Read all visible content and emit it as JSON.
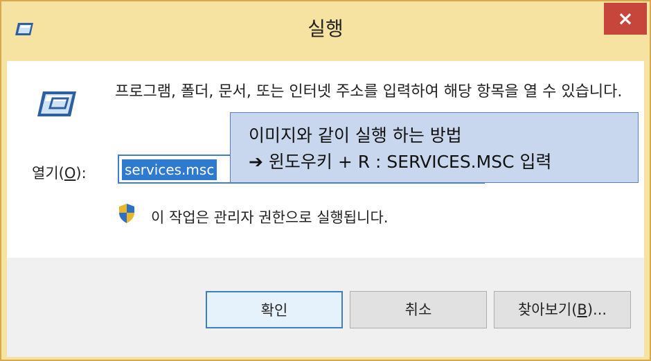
{
  "window": {
    "title": "실행",
    "close_label": "×"
  },
  "content": {
    "description": "프로그램, 폴더, 문서, 또는 인터넷 주소를 입력하여 해당 항목을 열 수 있습니다.",
    "open_label_prefix": "열기(",
    "open_label_key": "O",
    "open_label_suffix": "):",
    "input_value": "services.msc",
    "admin_text": "이 작업은 관리자 권한으로 실행됩니다."
  },
  "tooltip": {
    "line1": "이미지와 같이 실행 하는 방법",
    "line2": "➔ 윈도우키 + R : SERVICES.MSC 입력"
  },
  "buttons": {
    "ok": "확인",
    "cancel": "취소",
    "browse_prefix": "찾아보기(",
    "browse_key": "B",
    "browse_suffix": ")..."
  },
  "colors": {
    "titlebar": "#f7e3a1",
    "close": "#c7463c",
    "selection": "#2f7ad1",
    "tooltip_bg": "#c9d7ee"
  }
}
